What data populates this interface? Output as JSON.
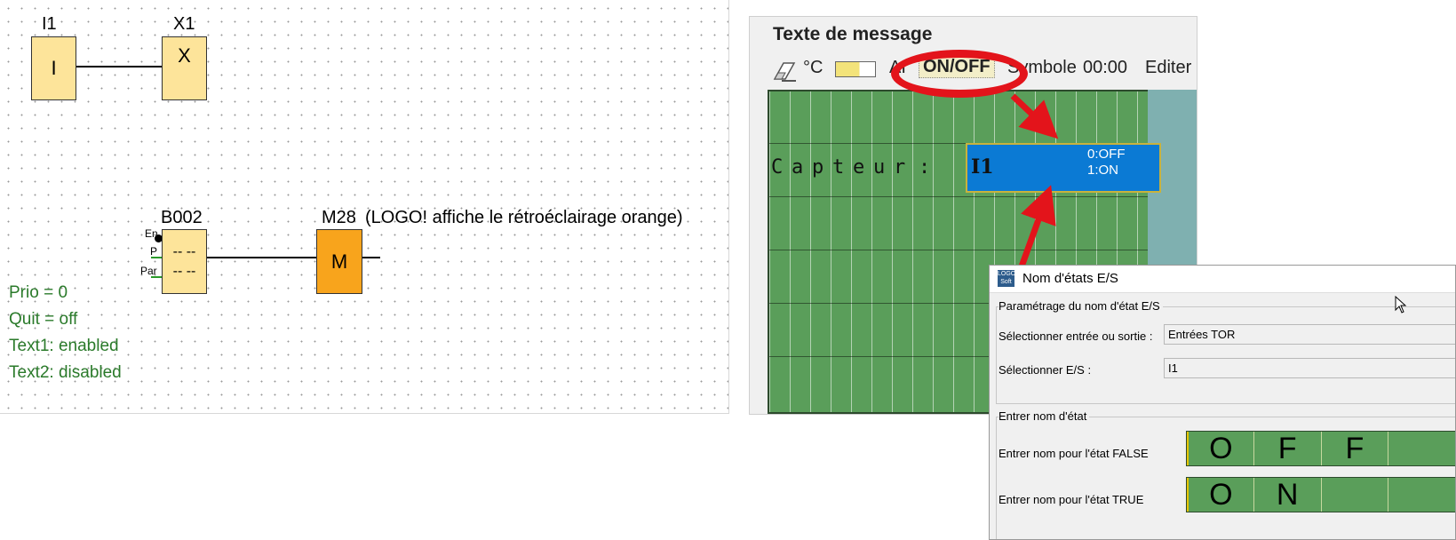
{
  "fbd": {
    "i1_label": "I1",
    "i1_block": "I",
    "x1_label": "X1",
    "x1_block": "X",
    "b002_label": "B002",
    "b002_pins": {
      "en": "En",
      "p": "P",
      "par": "Par"
    },
    "b002_block_line1": "-- --",
    "b002_block_line2": "-- --",
    "m28_label": "M28",
    "m28_note": "(LOGO! affiche le rétroéclairage orange)",
    "m28_block": "M",
    "params": [
      "Prio = 0",
      "Quit = off",
      "Text1: enabled",
      "Text2: disabled"
    ]
  },
  "message_editor": {
    "title": "Texte de message",
    "toolbar": {
      "celsius_label": "°C",
      "ai_label": "AI",
      "onoff_label": "ON/OFF",
      "symbol_label": "Symbole",
      "time_label": "00:00",
      "edit_label": "Editer"
    },
    "lcd_text": [
      "C",
      "a",
      "p",
      "t",
      "e",
      "u",
      "r",
      ":"
    ],
    "value_io": "I1",
    "value_states": [
      "0:OFF",
      "1:ON"
    ]
  },
  "dialog": {
    "title": "Nom d'états E/S",
    "group1_title": "Paramétrage du nom d'état E/S",
    "select_io_type_label": "Sélectionner entrée ou sortie :",
    "select_io_type_value": "Entrées TOR",
    "select_io_label": "Sélectionner E/S :",
    "select_io_value": "I1",
    "group2_title": "Entrer nom d'état",
    "false_label": "Entrer nom pour l'état FALSE",
    "false_chars": [
      "O",
      "F",
      "F",
      ""
    ],
    "true_label": "Entrer nom pour l'état TRUE",
    "true_chars": [
      "O",
      "N",
      "",
      ""
    ]
  },
  "colors": {
    "block_fill": "#fde49a",
    "output_fill": "#f8a41c",
    "lcd_green": "#5a9e5a",
    "highlight_blue": "#0b7ad4",
    "callout_red": "#e3141b",
    "param_green": "#2a7a2a"
  }
}
